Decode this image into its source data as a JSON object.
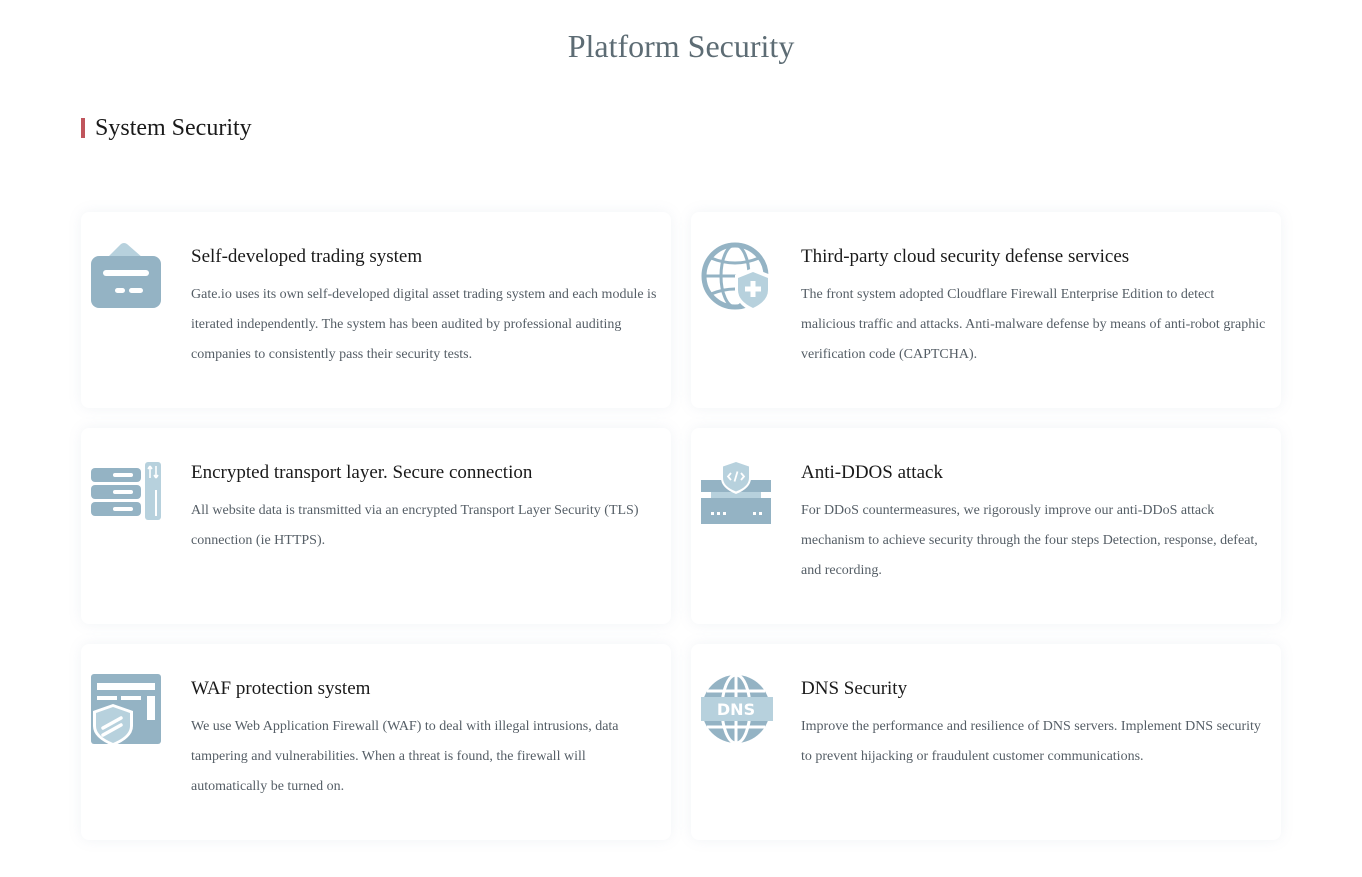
{
  "page": {
    "title": "Platform Security"
  },
  "section": {
    "heading": "System Security",
    "accent_color": "#c0555c"
  },
  "icon_colors": {
    "primary": "#94b3c4",
    "light": "#b7d1dd"
  },
  "cards": [
    {
      "icon": "credit-card-icon",
      "title": "Self-developed trading system",
      "description": "Gate.io uses its own self-developed digital asset trading system and each module is iterated independently. The system has been audited by professional auditing companies to consistently pass their security tests."
    },
    {
      "icon": "globe-shield-icon",
      "title": "Third-party cloud security defense services",
      "description": "The front system adopted Cloudflare Firewall Enterprise Edition to detect malicious traffic and attacks. Anti-malware defense by means of anti-robot graphic verification code (CAPTCHA)."
    },
    {
      "icon": "server-transfer-icon",
      "title": "Encrypted transport layer. Secure connection",
      "description": "All website data is transmitted via an encrypted Transport Layer Security (TLS) connection (ie HTTPS)."
    },
    {
      "icon": "shield-server-icon",
      "title": "Anti-DDOS attack",
      "description": "For DDoS countermeasures, we rigorously improve our anti-DDoS attack mechanism to achieve security through the four steps Detection, response, defeat, and recording."
    },
    {
      "icon": "firewall-window-icon",
      "title": "WAF protection system",
      "description": "We use Web Application Firewall (WAF) to deal with illegal intrusions, data tampering and vulnerabilities. When a threat is found, the firewall will automatically be turned on."
    },
    {
      "icon": "dns-globe-icon",
      "title": "DNS Security",
      "icon_text": "DNS",
      "description": "Improve the performance and resilience of DNS servers. Implement DNS security to prevent hijacking or fraudulent customer communications."
    }
  ]
}
